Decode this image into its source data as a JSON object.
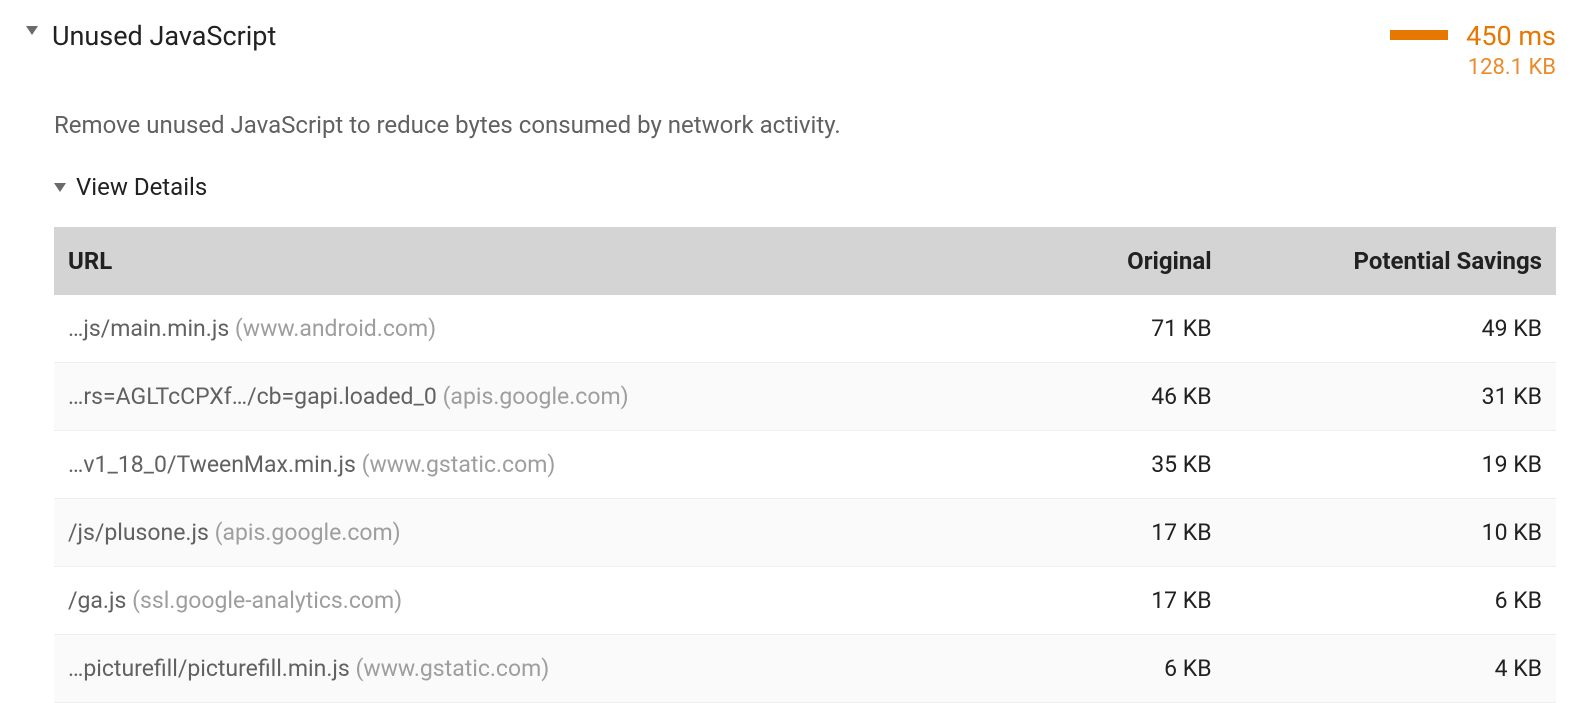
{
  "audit": {
    "title": "Unused JavaScript",
    "description": "Remove unused JavaScript to reduce bytes consumed by network activity.",
    "time_metric": "450 ms",
    "bytes_metric": "128.1 KB",
    "details_label": "View Details"
  },
  "table": {
    "headers": {
      "url": "URL",
      "original": "Original",
      "savings": "Potential Savings"
    },
    "rows": [
      {
        "path": "…js/main.min.js",
        "host": "(www.android.com)",
        "original": "71 KB",
        "savings": "49 KB"
      },
      {
        "path": "…rs=AGLTcCPXf…/cb=gapi.loaded_0",
        "host": "(apis.google.com)",
        "original": "46 KB",
        "savings": "31 KB"
      },
      {
        "path": "…v1_18_0/TweenMax.min.js",
        "host": "(www.gstatic.com)",
        "original": "35 KB",
        "savings": "19 KB"
      },
      {
        "path": "/js/plusone.js",
        "host": "(apis.google.com)",
        "original": "17 KB",
        "savings": "10 KB"
      },
      {
        "path": "/ga.js",
        "host": "(ssl.google-analytics.com)",
        "original": "17 KB",
        "savings": "6 KB"
      },
      {
        "path": "…picturefill/picturefill.min.js",
        "host": "(www.gstatic.com)",
        "original": "6 KB",
        "savings": "4 KB"
      }
    ]
  }
}
